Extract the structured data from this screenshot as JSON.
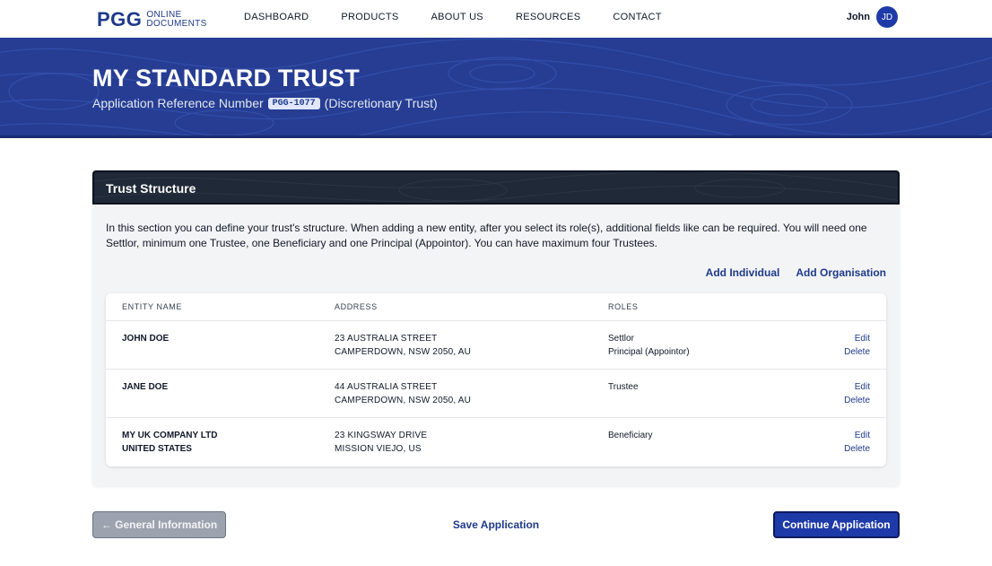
{
  "nav": {
    "logo_mark": "PGG",
    "logo_line1": "ONLINE",
    "logo_line2": "DOCUMENTS",
    "links": [
      "DASHBOARD",
      "PRODUCTS",
      "ABOUT US",
      "RESOURCES",
      "CONTACT"
    ],
    "user_name": "John",
    "user_initials": "JD"
  },
  "hero": {
    "title": "MY STANDARD TRUST",
    "ref_label": "Application Reference Number",
    "ref_number": "PGG-1077",
    "trust_type": "(Discretionary Trust)"
  },
  "section": {
    "title": "Trust Structure",
    "description": "In this section you can define your trust's structure. When adding a new entity, after you select its role(s), additional fields like can be required. You will need one Settlor, minimum one Trustee, one Beneficiary and one Principal (Appointor). You can have maximum four Trustees.",
    "add_individual": "Add Individual",
    "add_organisation": "Add Organisation"
  },
  "table": {
    "headers": [
      "ENTITY NAME",
      "ADDRESS",
      "ROLES"
    ],
    "rows": [
      {
        "name": [
          "JOHN DOE"
        ],
        "address": [
          "23 AUSTRALIA STREET",
          "CAMPERDOWN, NSW 2050, AU"
        ],
        "roles": [
          "Settlor",
          "Principal (Appointor)"
        ],
        "edit": "Edit",
        "delete": "Delete"
      },
      {
        "name": [
          "JANE DOE"
        ],
        "address": [
          "44 AUSTRALIA STREET",
          "CAMPERDOWN, NSW 2050, AU"
        ],
        "roles": [
          "Trustee"
        ],
        "edit": "Edit",
        "delete": "Delete"
      },
      {
        "name": [
          "MY UK COMPANY LTD",
          "UNITED STATES"
        ],
        "address": [
          "23 KINGSWAY DRIVE",
          "MISSION VIEJO, US"
        ],
        "roles": [
          "Beneficiary"
        ],
        "edit": "Edit",
        "delete": "Delete"
      }
    ]
  },
  "footer": {
    "back_label": "← General Information",
    "save_label": "Save Application",
    "continue_label": "Continue Application"
  },
  "colors": {
    "brand": "#1e3a8a",
    "hero_bg": "#263d93",
    "header_dark": "#1f2937",
    "primary_button": "#1e3aa8",
    "disabled_button": "#9ca3af"
  }
}
